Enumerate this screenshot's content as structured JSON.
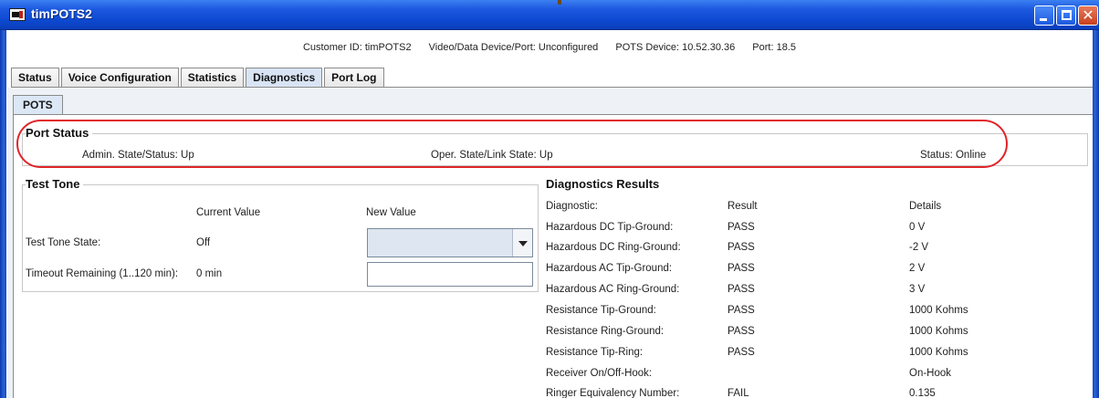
{
  "window": {
    "title": "timPOTS2",
    "icon": "app-logo-icon",
    "controls": [
      "minimize-icon",
      "maximize-icon",
      "close-icon"
    ],
    "close_glyph": "✕"
  },
  "info": {
    "customer_id": "Customer ID: timPOTS2",
    "video_port": "Video/Data Device/Port: Unconfigured",
    "pots_device": "POTS Device: 10.52.30.36",
    "port": "Port: 18.5"
  },
  "tabs": [
    {
      "label": "Status"
    },
    {
      "label": "Voice Configuration"
    },
    {
      "label": "Statistics"
    },
    {
      "label": "Diagnostics",
      "active": true
    },
    {
      "label": "Port Log"
    }
  ],
  "subtab": {
    "label": "POTS"
  },
  "port_status": {
    "title": "Port Status",
    "admin": "Admin. State/Status: Up",
    "oper": "Oper. State/Link State: Up",
    "status": "Status: Online"
  },
  "test_tone": {
    "title": "Test Tone",
    "current_value_header": "Current Value",
    "new_value_header": "New Value",
    "state_label": "Test Tone State:",
    "state_value": "Off",
    "timeout_label": "Timeout Remaining (1..120 min):",
    "timeout_value": "0 min"
  },
  "diagnostics": {
    "title": "Diagnostics Results",
    "headers": {
      "diagnostic": "Diagnostic:",
      "result": "Result",
      "details": "Details"
    },
    "rows": [
      {
        "name": "Hazardous DC Tip-Ground:",
        "result": "PASS",
        "details": "0 V"
      },
      {
        "name": "Hazardous DC Ring-Ground:",
        "result": "PASS",
        "details": "-2 V"
      },
      {
        "name": "Hazardous AC Tip-Ground:",
        "result": "PASS",
        "details": "2 V"
      },
      {
        "name": "Hazardous AC Ring-Ground:",
        "result": "PASS",
        "details": "3 V"
      },
      {
        "name": "Resistance Tip-Ground:",
        "result": "PASS",
        "details": "1000 Kohms"
      },
      {
        "name": "Resistance Ring-Ground:",
        "result": "PASS",
        "details": "1000 Kohms"
      },
      {
        "name": "Resistance Tip-Ring:",
        "result": "PASS",
        "details": "1000 Kohms"
      },
      {
        "name": "Receiver On/Off-Hook:",
        "result": "",
        "details": "On-Hook"
      },
      {
        "name": "Ringer Equivalency Number:",
        "result": "FAIL",
        "details": "0.135"
      }
    ]
  },
  "colors": {
    "titlebar": "#0d48d0",
    "highlight": "#e0242a",
    "active_tab": "#d8e4f4"
  }
}
